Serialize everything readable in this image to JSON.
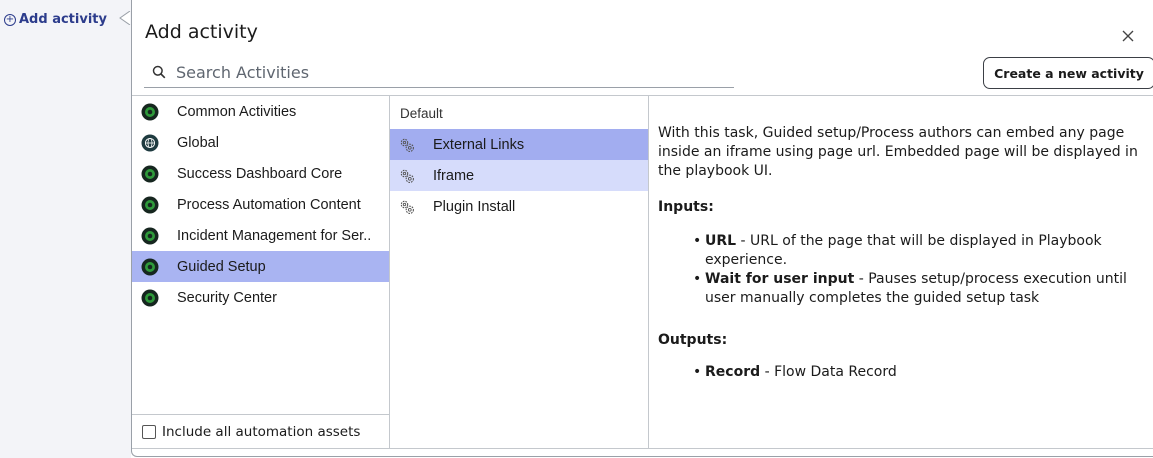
{
  "trigger": {
    "label": "Add activity",
    "icon": "plus-circle-icon"
  },
  "dialog": {
    "title": "Add activity",
    "close_icon": "close-icon",
    "search": {
      "placeholder": "Search Activities",
      "value": ""
    },
    "create_button": "Create a new activity"
  },
  "categories": {
    "items": [
      {
        "label": "Common Activities",
        "icon": "category-dot-icon",
        "selected": false
      },
      {
        "label": "Global",
        "icon": "globe-icon",
        "selected": false
      },
      {
        "label": "Success Dashboard Core",
        "icon": "category-dot-icon",
        "selected": false
      },
      {
        "label": "Process Automation Content",
        "icon": "category-dot-icon",
        "selected": false
      },
      {
        "label": "Incident Management for Ser..",
        "icon": "category-dot-icon",
        "selected": false
      },
      {
        "label": "Guided Setup",
        "icon": "category-dot-icon",
        "selected": true
      },
      {
        "label": "Security Center",
        "icon": "category-dot-icon",
        "selected": false
      }
    ],
    "include_checkbox": {
      "label": "Include all automation assets",
      "checked": false
    }
  },
  "activities": {
    "header": "Default",
    "items": [
      {
        "label": "External Links",
        "icon": "gears-icon",
        "state": "selected"
      },
      {
        "label": "Iframe",
        "icon": "gears-icon",
        "state": "hover"
      },
      {
        "label": "Plugin Install",
        "icon": "gears-icon",
        "state": "none"
      }
    ]
  },
  "description": {
    "intro": "With this task, Guided setup/Process authors can embed any page inside an iframe using page url. Embedded page will be displayed in the playbook UI.",
    "inputs_heading": "Inputs:",
    "inputs": [
      {
        "name": "URL",
        "text": " - URL of the page that will be displayed in Playbook experience."
      },
      {
        "name": "Wait for user input",
        "text": " - Pauses setup/process execution until user manually completes the guided setup task"
      }
    ],
    "outputs_heading": "Outputs:",
    "outputs": [
      {
        "name": "Record",
        "text": " - Flow Data Record"
      }
    ]
  },
  "colors": {
    "accent": "#2c3c8c",
    "selected_row": "#a9b4f2",
    "hover_row": "#d6dcfb",
    "category_dot": "#2e9a3a"
  }
}
